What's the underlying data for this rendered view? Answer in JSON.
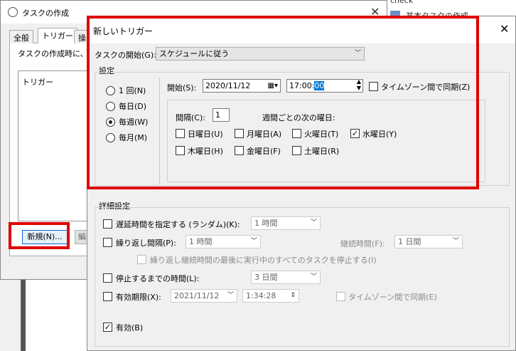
{
  "background_window": {
    "title": "タスクの作成",
    "tabs": [
      "全般",
      "トリガー",
      "操"
    ],
    "description": "タスクの作成時に、タ",
    "list_header": "トリガー",
    "new_button": "新規(N)...",
    "edit_button": "編"
  },
  "right_strip": {
    "label": "check",
    "item": "基本タスクの作成"
  },
  "dialog": {
    "title": "新しいトリガー",
    "begin_task_label": "タスクの開始(G):",
    "begin_task_value": "スケジュールに従う",
    "settings_label": "設定",
    "schedule_options": [
      "1 回(N)",
      "毎日(D)",
      "毎週(W)",
      "毎月(M)"
    ],
    "selected_schedule": "毎週(W)",
    "start_label": "開始(S):",
    "start_date": "2020/11/12",
    "start_time_prefix": "17:00:",
    "start_time_selected": "00",
    "sync_timezone_label": "タイムゾーン間で同期(Z)",
    "interval_label": "間隔(C):",
    "interval_value": "1",
    "weekday_caption": "週間ごとの次の曜日:",
    "weekdays": [
      {
        "label": "日曜日(U)",
        "checked": false
      },
      {
        "label": "月曜日(A)",
        "checked": false
      },
      {
        "label": "火曜日(T)",
        "checked": false
      },
      {
        "label": "水曜日(Y)",
        "checked": true
      },
      {
        "label": "木曜日(H)",
        "checked": false
      },
      {
        "label": "金曜日(F)",
        "checked": false
      },
      {
        "label": "土曜日(R)",
        "checked": false
      }
    ],
    "advanced_label": "詳細設定",
    "delay_label": "遅延時間を指定する (ランダム)(K):",
    "delay_value": "1 時間",
    "repeat_label": "繰り返し間隔(P):",
    "repeat_value": "1 時間",
    "duration_label": "継続時間(F):",
    "duration_value": "1 日間",
    "stop_all_label": "繰り返し継続時間の最後に実行中のすべてのタスクを停止する(I)",
    "stop_after_label": "停止するまでの時間(L):",
    "stop_after_value": "3 日間",
    "expire_label": "有効期限(X):",
    "expire_date": "2021/11/12",
    "expire_time": "1:34:28",
    "expire_sync_label": "タイムゾーン間で同期(E)",
    "enabled_label": "有効(B)"
  },
  "colors": {
    "highlight_box": "#e00000",
    "selection": "#0078d7"
  }
}
